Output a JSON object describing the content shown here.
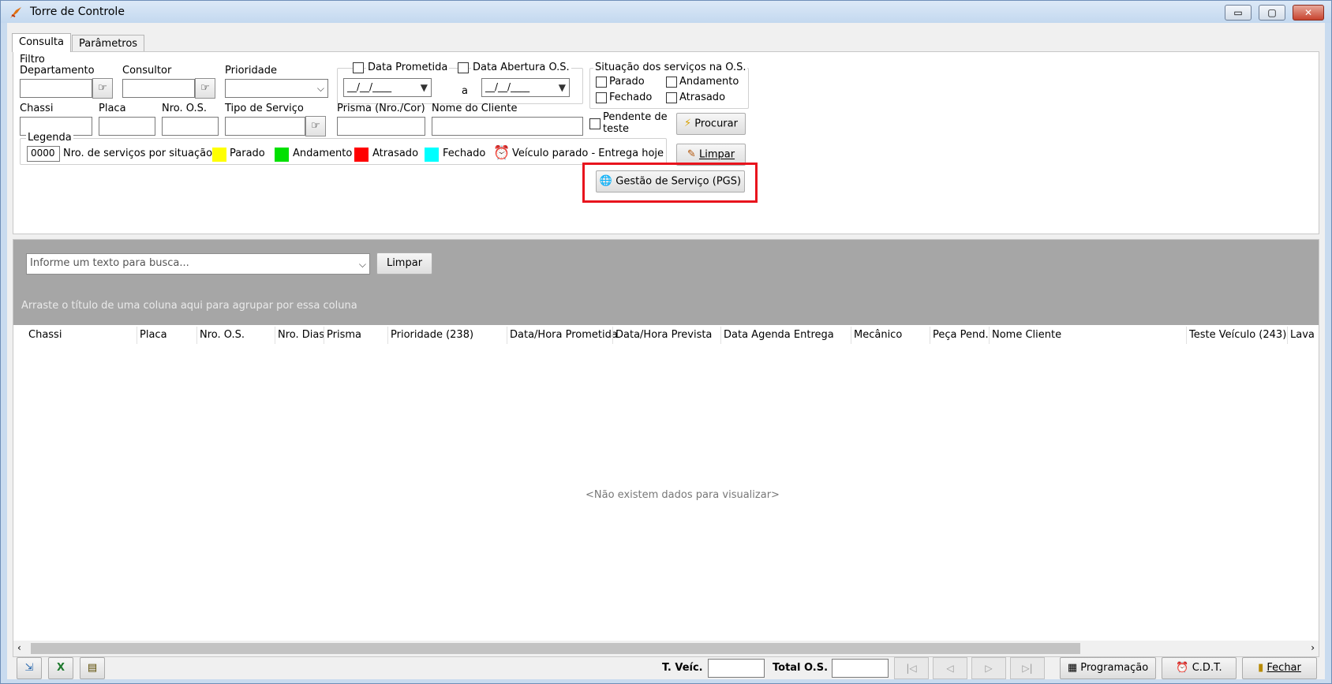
{
  "window": {
    "title": "Torre de Controle",
    "minimize": "▭",
    "restore": "▢",
    "close": "✕"
  },
  "tabs": [
    {
      "label": "Consulta"
    },
    {
      "label": "Parâmetros"
    }
  ],
  "filtro": {
    "group_title": "Filtro",
    "departamento": "Departamento",
    "consultor": "Consultor",
    "prioridade": "Prioridade",
    "data_prometida": "Data Prometida",
    "data_abertura": "Data Abertura O.S.",
    "date_from": "__/__/____",
    "date_to": "__/__/____",
    "a": "a",
    "chassi": "Chassi",
    "placa": "Placa",
    "nro_os": "Nro. O.S.",
    "tipo_servico": "Tipo de Serviço",
    "prisma": "Prisma (Nro./Cor)",
    "nome_cliente": "Nome do Cliente",
    "pendente_teste": "Pendente de teste"
  },
  "situacao": {
    "title": "Situação dos serviços na O.S.",
    "parado": "Parado",
    "andamento": "Andamento",
    "fechado": "Fechado",
    "atrasado": "Atrasado"
  },
  "legenda": {
    "title": "Legenda",
    "count_box": "0000",
    "count_label": "Nro. de serviços por situação",
    "items": [
      {
        "label": "Parado",
        "color": "#ffff00"
      },
      {
        "label": "Andamento",
        "color": "#00e000"
      },
      {
        "label": "Atrasado",
        "color": "#ff0000"
      },
      {
        "label": "Fechado",
        "color": "#00ffff"
      }
    ],
    "alarm_label": "Veículo parado - Entrega hoje"
  },
  "buttons": {
    "procurar": "Procurar",
    "limpar_filtro": "Limpar",
    "gestao": "Gestão de Serviço (PGS)",
    "limpar_busca": "Limpar",
    "programacao": "Programação",
    "cdt": "C.D.T.",
    "fechar": "Fechar"
  },
  "search": {
    "placeholder": "Informe um texto para busca..."
  },
  "grid": {
    "group_hint": "Arraste o título de uma coluna aqui para agrupar por essa coluna",
    "columns": [
      "Chassi",
      "Placa",
      "Nro. O.S.",
      "Nro. Dias",
      "Prisma",
      "Prioridade (238)",
      "Data/Hora Prometida",
      "Data/Hora Prevista",
      "Data Agenda Entrega",
      "Mecânico",
      "Peça Pend.",
      "Nome Cliente",
      "Teste Veículo (243)",
      "Lava"
    ],
    "empty": "<Não existem dados para visualizar>"
  },
  "footer": {
    "t_veic": "T. Veíc.",
    "total_os": "Total O.S."
  },
  "colors": {
    "highlight": "#e8141d",
    "grid_top": "#a6a6a6"
  }
}
